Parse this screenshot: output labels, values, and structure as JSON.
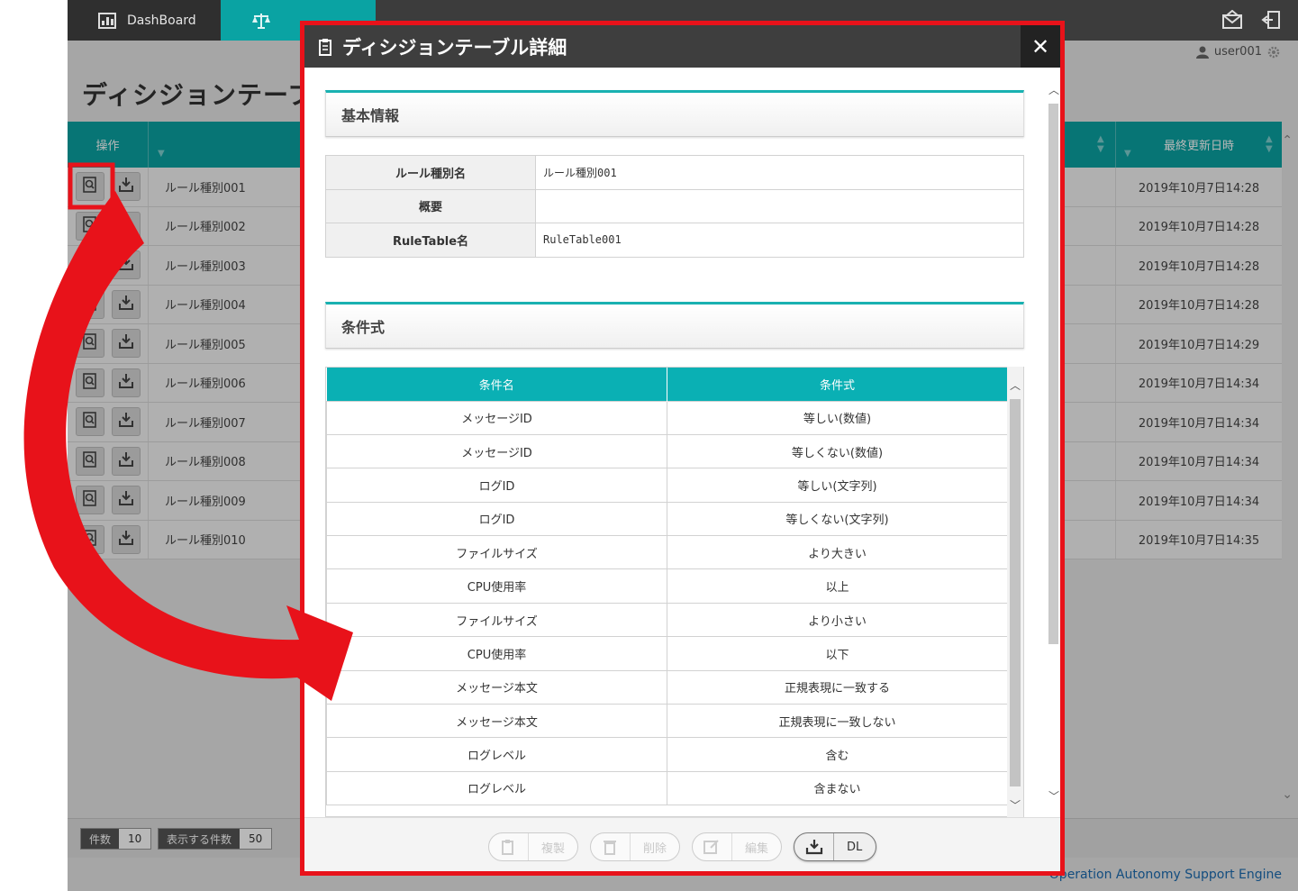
{
  "topbar": {
    "tab_dashboard": "DashBoard",
    "tab_rule": "",
    "tab_other": "",
    "user": "user001"
  },
  "page": {
    "title": "ディシジョンテーブル"
  },
  "grid": {
    "col_operation": "操作",
    "col_updated": "最終更新日時",
    "rows": [
      {
        "name": "ルール種別001",
        "updated": "2019年10月7日14:28"
      },
      {
        "name": "ルール種別002",
        "updated": "2019年10月7日14:28"
      },
      {
        "name": "ルール種別003",
        "updated": "2019年10月7日14:28"
      },
      {
        "name": "ルール種別004",
        "updated": "2019年10月7日14:28"
      },
      {
        "name": "ルール種別005",
        "updated": "2019年10月7日14:29"
      },
      {
        "name": "ルール種別006",
        "updated": "2019年10月7日14:34"
      },
      {
        "name": "ルール種別007",
        "updated": "2019年10月7日14:34"
      },
      {
        "name": "ルール種別008",
        "updated": "2019年10月7日14:34"
      },
      {
        "name": "ルール種別009",
        "updated": "2019年10月7日14:34"
      },
      {
        "name": "ルール種別010",
        "updated": "2019年10月7日14:35"
      }
    ]
  },
  "footer": {
    "count_label": "件数",
    "count_value": "10",
    "display_label": "表示する件数",
    "display_value": "50",
    "brand": "Operation Autonomy Support Engine"
  },
  "modal": {
    "title": "ディシジョンテーブル詳細",
    "close": "✕",
    "basic_section": "基本情報",
    "info": [
      {
        "key": "ルール種別名",
        "value": "ルール種別001"
      },
      {
        "key": "概要",
        "value": ""
      },
      {
        "key": "RuleTable名",
        "value": "RuleTable001"
      }
    ],
    "cond_section": "条件式",
    "cond_headers": [
      "条件名",
      "条件式"
    ],
    "conditions": [
      {
        "name": "メッセージID",
        "expr": "等しい(数値)"
      },
      {
        "name": "メッセージID",
        "expr": "等しくない(数値)"
      },
      {
        "name": "ログID",
        "expr": "等しい(文字列)"
      },
      {
        "name": "ログID",
        "expr": "等しくない(文字列)"
      },
      {
        "name": "ファイルサイズ",
        "expr": "より大きい"
      },
      {
        "name": "CPU使用率",
        "expr": "以上"
      },
      {
        "name": "ファイルサイズ",
        "expr": "より小さい"
      },
      {
        "name": "CPU使用率",
        "expr": "以下"
      },
      {
        "name": "メッセージ本文",
        "expr": "正規表現に一致する"
      },
      {
        "name": "メッセージ本文",
        "expr": "正規表現に一致しない"
      },
      {
        "name": "ログレベル",
        "expr": "含む"
      },
      {
        "name": "ログレベル",
        "expr": "含まない"
      }
    ],
    "buttons": {
      "copy": "複製",
      "delete": "削除",
      "edit": "編集",
      "download": "DL"
    }
  },
  "colors": {
    "teal": "#0aa3a3",
    "highlight_red": "#e8121a",
    "header_dark": "#3e3e3e"
  }
}
